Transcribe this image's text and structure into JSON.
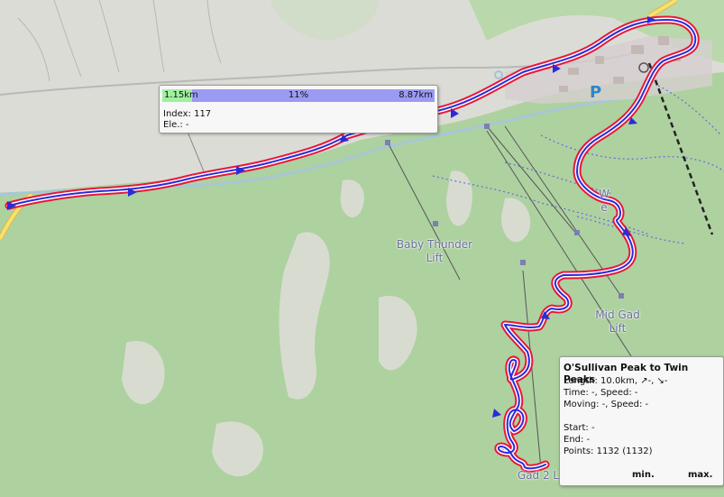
{
  "map": {
    "labels": [
      {
        "name": "baby-thunder-lift-label",
        "lines": [
          "Baby Thunder",
          "Lift"
        ]
      },
      {
        "name": "mid-gad-lift-label",
        "lines": [
          "Mid Gad",
          "Lift"
        ]
      },
      {
        "name": "gad2-label",
        "lines": [
          "Gad 2 L"
        ]
      },
      {
        "name": "wildflower-label",
        "lines": [
          "W",
          "e"
        ]
      }
    ],
    "parking_symbol": "P",
    "colors": {
      "track_outer": "#e8173a",
      "track_inner": "#2b2bd8",
      "forest": "#aed1a0",
      "meadow": "#dcdcd6",
      "road": "#f7e06e",
      "river": "#a7c7d6"
    }
  },
  "tooltip": {
    "left_value": "1.15km",
    "percent_text": "11%",
    "percent": 11,
    "right_value": "8.87km",
    "index_line": "Index: 117",
    "ele_line": "Ele.: -"
  },
  "info": {
    "title": "O'Sullivan Peak to Twin Peaks",
    "length": "Length: 10.0km, ↗-, ↘-",
    "time": "Time: -, Speed: -",
    "moving": "Moving: -, Speed: -",
    "start": "Start: -",
    "end": "End: -",
    "points": "Points: 1132 (1132)",
    "min_label": "min.",
    "max_label": "max."
  }
}
